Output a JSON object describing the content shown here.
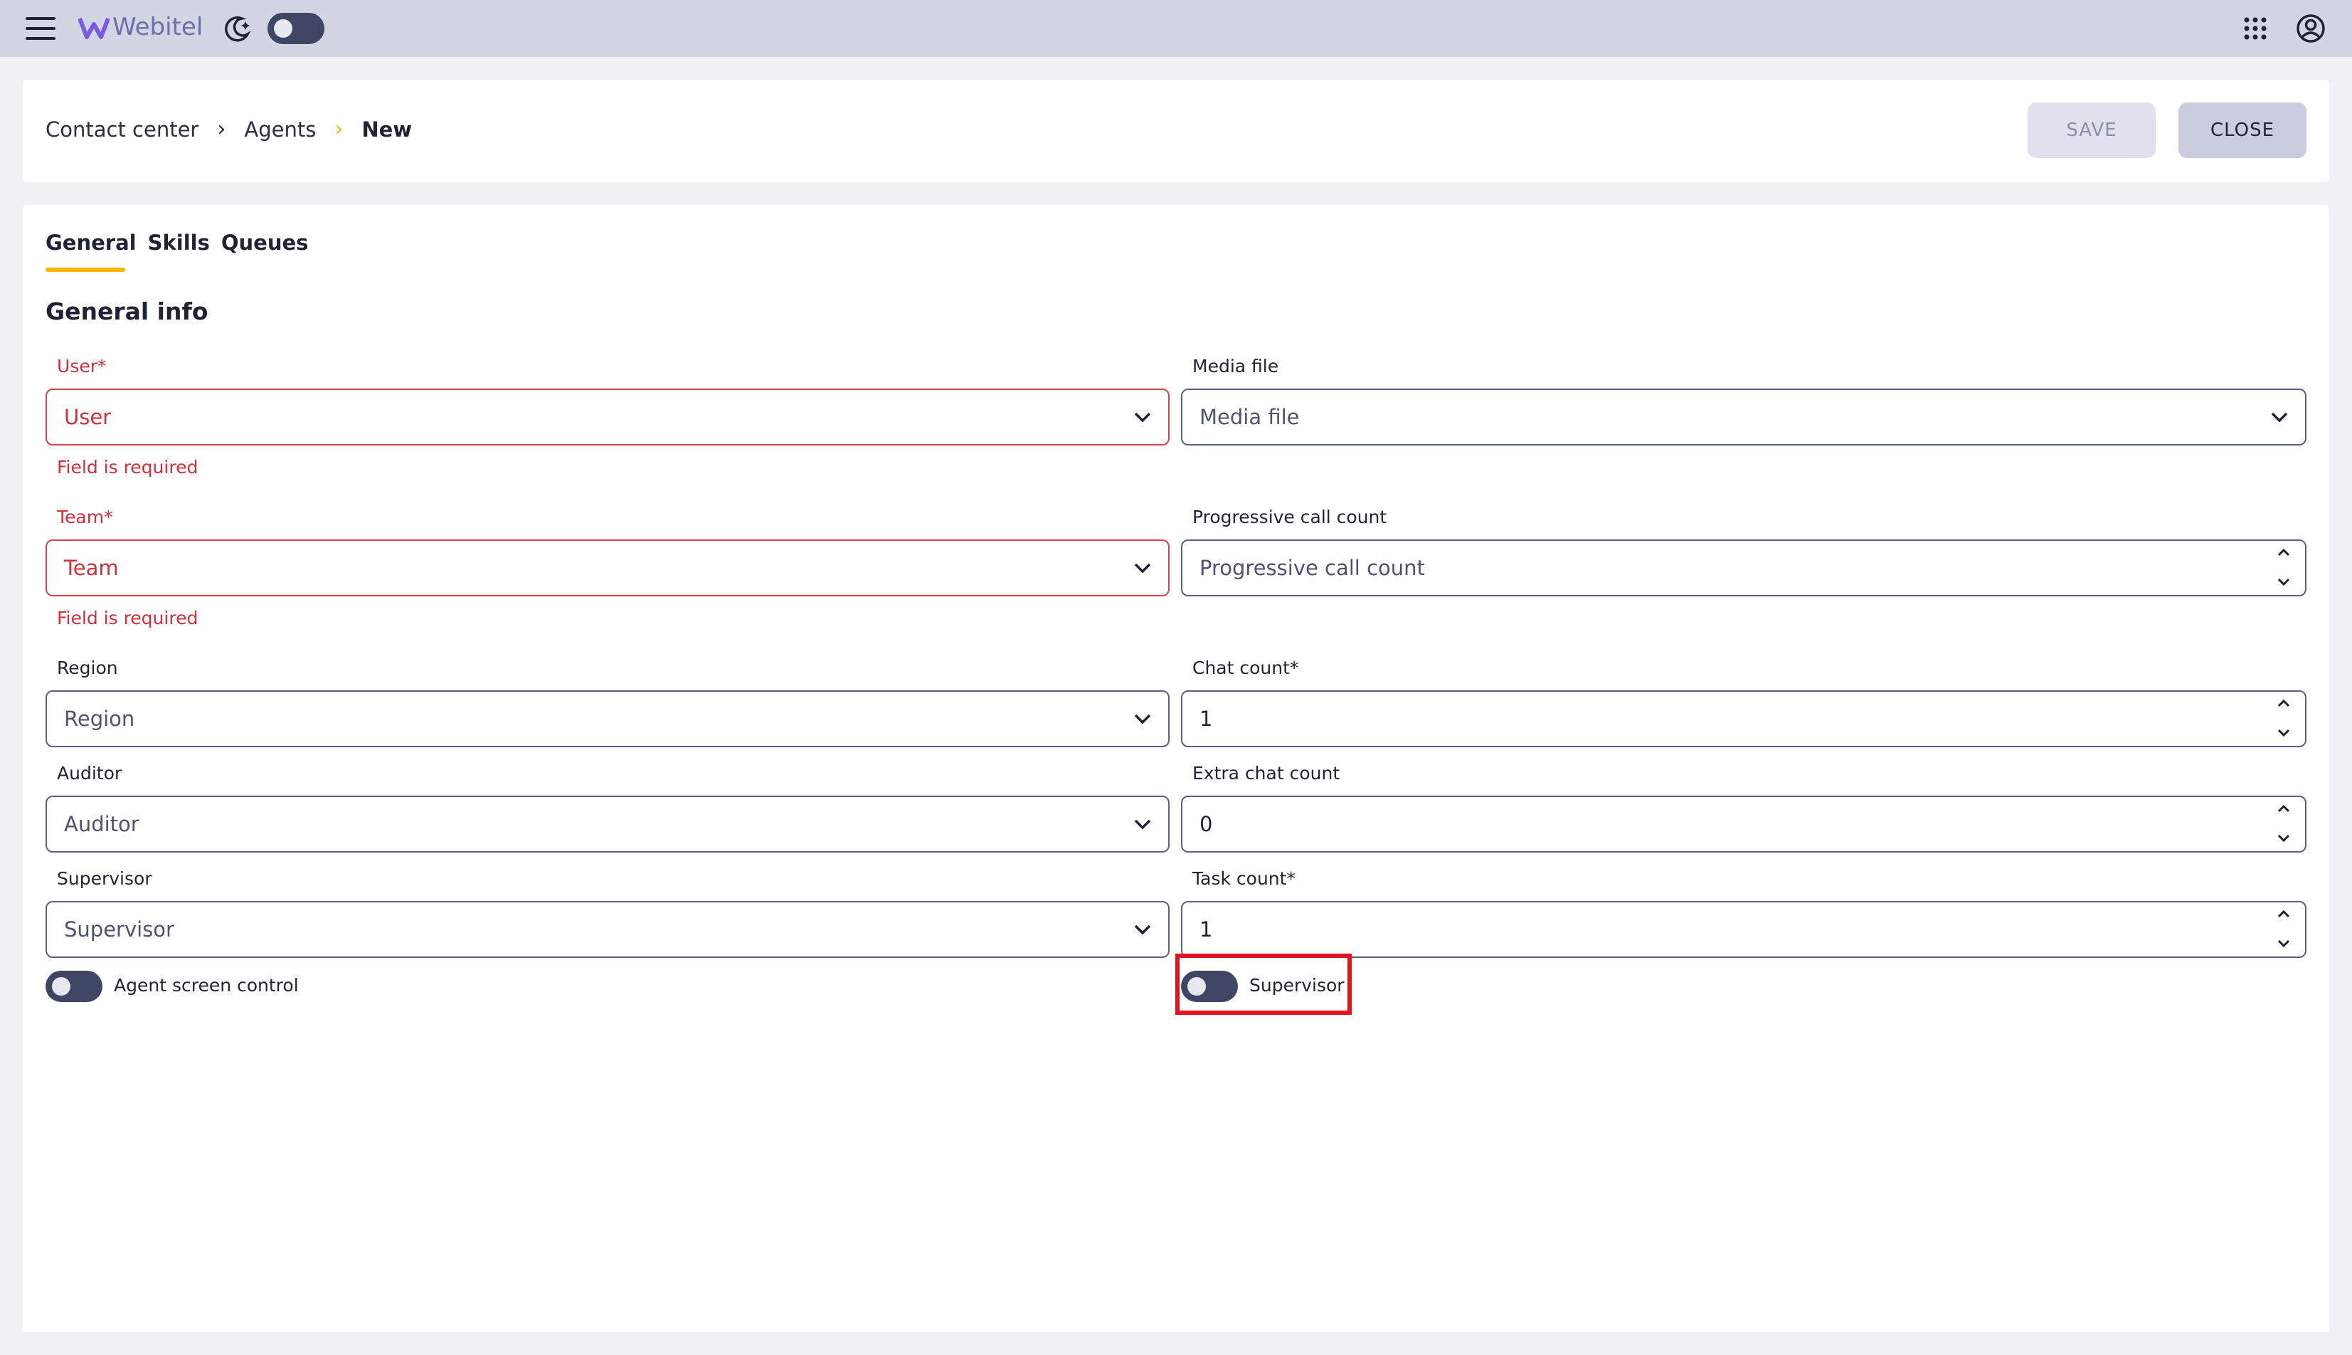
{
  "header": {
    "brand": "Webitel",
    "theme_toggle": "off"
  },
  "breadcrumb": {
    "items": [
      "Contact center",
      "Agents",
      "New"
    ],
    "separators": [
      "›",
      "›"
    ]
  },
  "actions": {
    "save_label": "SAVE",
    "close_label": "CLOSE"
  },
  "tabs": {
    "items": [
      "General",
      "Skills",
      "Queues"
    ],
    "active": "General"
  },
  "section": {
    "title": "General info"
  },
  "form": {
    "user": {
      "label": "User*",
      "placeholder": "User",
      "error": "Field is required"
    },
    "team": {
      "label": "Team*",
      "placeholder": "Team",
      "error": "Field is required"
    },
    "region": {
      "label": "Region",
      "placeholder": "Region"
    },
    "auditor": {
      "label": "Auditor",
      "placeholder": "Auditor"
    },
    "supervisor": {
      "label": "Supervisor",
      "placeholder": "Supervisor"
    },
    "media_file": {
      "label": "Media file",
      "placeholder": "Media file"
    },
    "progressive_call_count": {
      "label": "Progressive call count",
      "placeholder": "Progressive call count"
    },
    "chat_count": {
      "label": "Chat count*",
      "value": "1"
    },
    "extra_chat_count": {
      "label": "Extra chat count",
      "value": "0"
    },
    "task_count": {
      "label": "Task count*",
      "value": "1"
    },
    "agent_screen_control": {
      "label": "Agent screen control",
      "state": "off"
    },
    "supervisor_toggle": {
      "label": "Supervisor",
      "state": "off"
    }
  },
  "colors": {
    "accent": "#f5b800",
    "error": "#d32f3c",
    "highlight": "#e0141e",
    "toggle": "#3f4664"
  }
}
